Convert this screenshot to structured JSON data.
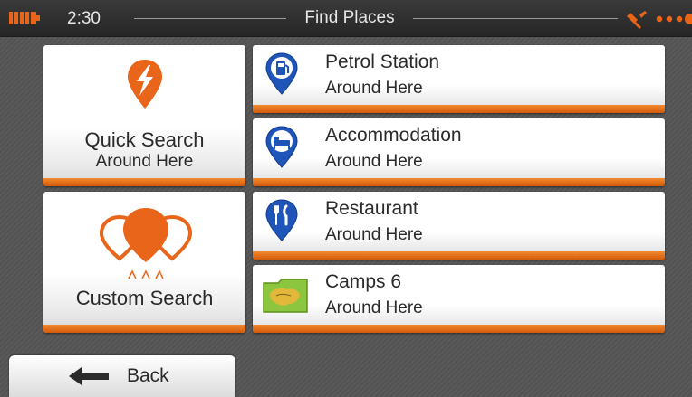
{
  "status_bar": {
    "time": "2:30",
    "title": "Find Places",
    "battery_icon": "battery-icon",
    "gps_icon": "satellite-signal-icon"
  },
  "quick_search": {
    "title": "Quick Search",
    "subtitle": "Around Here",
    "icon": "lightning-pin-icon"
  },
  "custom_search": {
    "title": "Custom Search",
    "icon": "balloons-icon"
  },
  "places": [
    {
      "title": "Petrol Station",
      "subtitle": "Around Here",
      "icon": "fuel-pump-icon"
    },
    {
      "title": "Accommodation",
      "subtitle": "Around Here",
      "icon": "bed-icon"
    },
    {
      "title": "Restaurant",
      "subtitle": "Around Here",
      "icon": "fork-knife-icon"
    },
    {
      "title": "Camps 6",
      "subtitle": "Around Here",
      "icon": "map-folder-icon"
    }
  ],
  "back": {
    "label": "Back",
    "icon": "back-arrow-icon"
  },
  "colors": {
    "accent_orange": "#e8651a",
    "pin_blue": "#1f55b8",
    "text_dark": "#2b2b2b",
    "status_text": "#e6e6e6"
  }
}
